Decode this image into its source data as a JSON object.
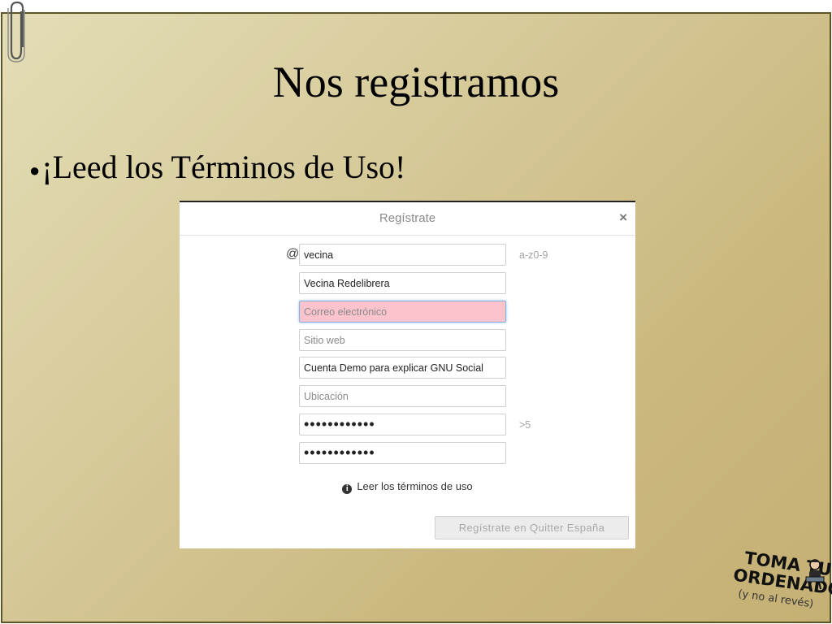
{
  "slide": {
    "title": "Nos registramos",
    "bullet": "¡Leed los Términos de Uso!"
  },
  "dialog": {
    "title": "Regístrate",
    "close_symbol": "×",
    "at_symbol": "@",
    "fields": {
      "nickname": {
        "value": "vecina",
        "placeholder": "",
        "hint": "a-z0-9"
      },
      "fullname": {
        "value": "Vecina Redelibrera",
        "placeholder": ""
      },
      "email": {
        "value": "",
        "placeholder": "Correo electrónico"
      },
      "website": {
        "value": "",
        "placeholder": "Sitio web"
      },
      "bio": {
        "value": "Cuenta Demo para explicar GNU Social",
        "placeholder": ""
      },
      "location": {
        "value": "",
        "placeholder": "Ubicación"
      },
      "password": {
        "value": "••••••••••••",
        "hint": ">5"
      },
      "password_confirm": {
        "value": "••••••••••••"
      }
    },
    "terms_link": "Leer los términos de uso",
    "submit_label": "Regístrate en Quitter España"
  },
  "logo": {
    "line1": "TOMA TU",
    "line2": "ORDENADOR",
    "line3": "(y no al revés)"
  },
  "colors": {
    "slide_border": "#5f5523",
    "error_field": "#fbc4cc",
    "focus_border": "#83b4e0"
  },
  "icons": [
    "paperclip-icon",
    "close-icon",
    "info-icon",
    "logo-figure-icon"
  ]
}
